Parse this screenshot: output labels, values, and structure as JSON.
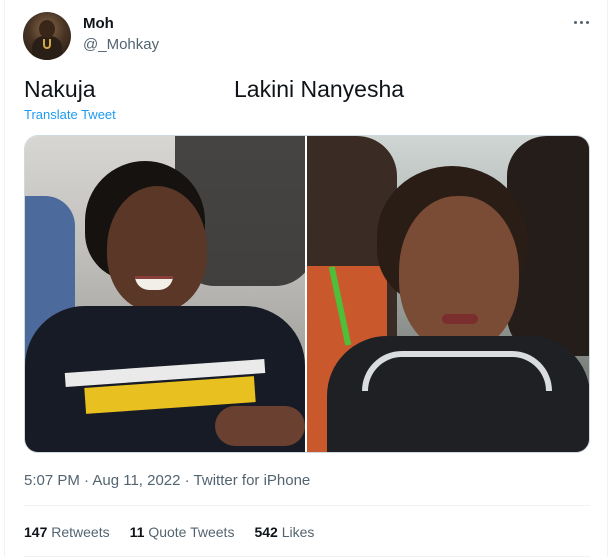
{
  "author": {
    "display_name": "Moh",
    "handle": "@_Mohkay"
  },
  "tweet": {
    "text_left": "Nakuja",
    "text_right": "Lakini Nanyesha",
    "translate_label": "Translate Tweet",
    "timestamp": "5:07 PM · Aug 11, 2022 · Twitter for iPhone"
  },
  "stats": {
    "retweets_count": "147",
    "retweets_label": "Retweets",
    "quote_tweets_count": "11",
    "quote_tweets_label": "Quote Tweets",
    "likes_count": "542",
    "likes_label": "Likes"
  },
  "icons": {
    "more": "more-horizontal-icon"
  },
  "colors": {
    "link": "#1d9bf0",
    "secondary_text": "#536471",
    "primary_text": "#0f1419"
  }
}
